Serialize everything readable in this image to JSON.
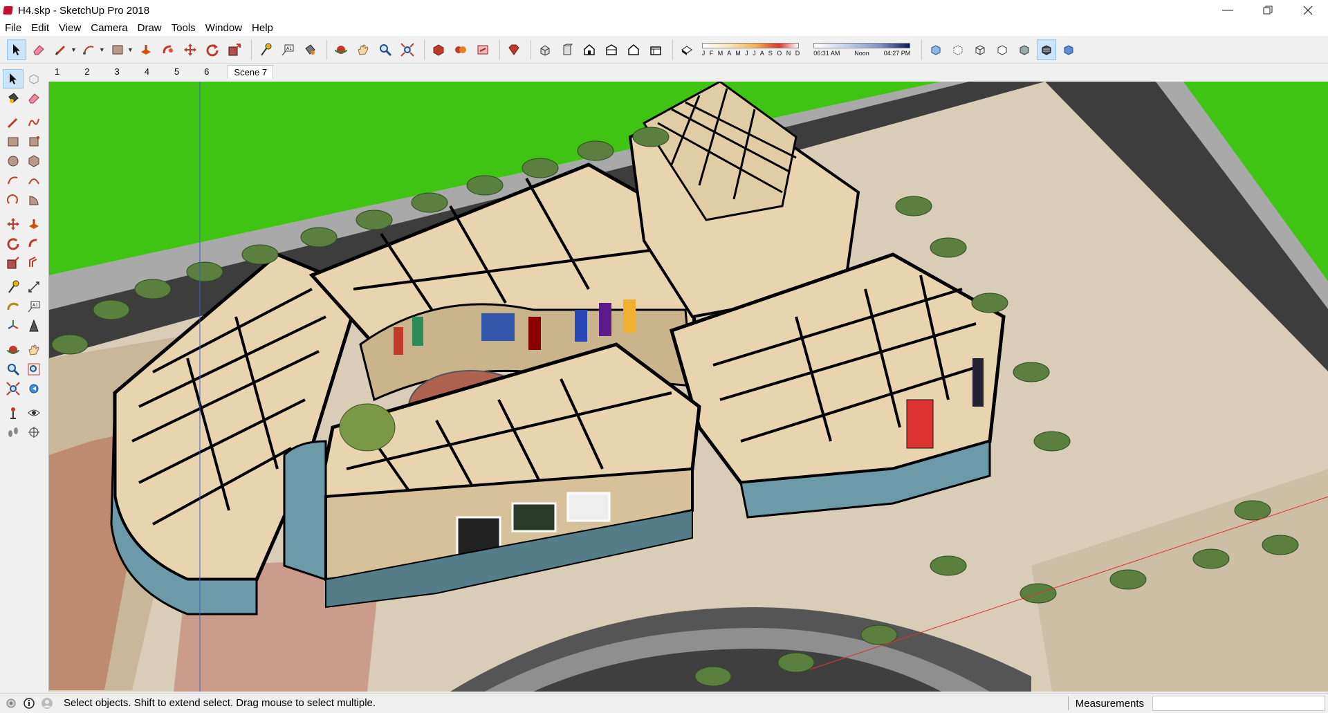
{
  "window": {
    "title": "H4.skp - SketchUp Pro 2018"
  },
  "menu": [
    "File",
    "Edit",
    "View",
    "Camera",
    "Draw",
    "Tools",
    "Window",
    "Help"
  ],
  "shadow": {
    "months": "J F M A M J J A S O N D",
    "time_start": "06:31 AM",
    "time_mid": "Noon",
    "time_end": "04:27 PM"
  },
  "scenes": [
    "1",
    "2",
    "3",
    "4",
    "5",
    "6",
    "Scene 7"
  ],
  "status": {
    "hint": "Select objects. Shift to extend select. Drag mouse to select multiple.",
    "measurements_label": "Measurements",
    "measurements_value": ""
  },
  "colors": {
    "accent": "#cce4f7",
    "sky_green": "#37c20f",
    "road": "#3d3d3d",
    "building_floor": "#e8d5b0",
    "glass": "#6d9aa8",
    "plaza": "#b06250"
  }
}
